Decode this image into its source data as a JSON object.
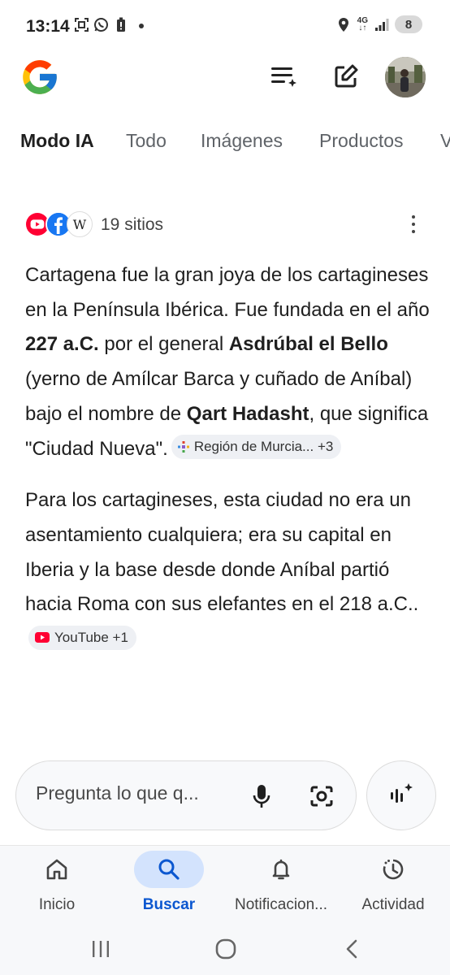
{
  "status_bar": {
    "time": "13:14",
    "network": "4G",
    "battery": "8",
    "icons": [
      "screenshot-icon",
      "whatsapp-icon",
      "battery-saver-icon",
      "location-icon",
      "signal-icon"
    ]
  },
  "header": {
    "logo": "google-logo",
    "icons": [
      "history-icon",
      "new-chat-icon",
      "avatar"
    ]
  },
  "tabs": [
    {
      "label": "Modo IA",
      "active": true
    },
    {
      "label": "Todo"
    },
    {
      "label": "Imágenes"
    },
    {
      "label": "Productos"
    },
    {
      "label": "V"
    }
  ],
  "sources": {
    "count_label": "19 sitios",
    "icons": [
      "youtube-icon",
      "facebook-icon",
      "wikipedia-icon"
    ]
  },
  "answer": {
    "p1": {
      "t1": "Cartagena fue la gran joya de los cartagineses en la Península Ibérica. Fue fundada en el año ",
      "b1": "227 a.C.",
      "t2": " por el general ",
      "b2": "Asdrúbal el Bello",
      "t3": " (yerno de Amílcar Barca y cuñado de Aníbal) bajo el nombre de ",
      "b3": "Qart Hadasht",
      "t4": ", que significa \"Ciudad Nueva\".",
      "chip": "Región de Murcia... +3"
    },
    "p2": {
      "text": "Para los cartagineses, esta ciudad no era un asentamiento cualquiera; era su capital en Iberia y la base desde donde Aníbal partió hacia Roma con sus elefantes en el 218 a.C..",
      "chip": "YouTube +1"
    }
  },
  "search": {
    "placeholder": "Pregunta lo que q..."
  },
  "bottom_nav": [
    {
      "label": "Inicio",
      "icon": "home-icon"
    },
    {
      "label": "Buscar",
      "icon": "search-icon",
      "active": true
    },
    {
      "label": "Notificacion...",
      "icon": "bell-icon"
    },
    {
      "label": "Actividad",
      "icon": "activity-icon"
    }
  ],
  "colors": {
    "accent": "#0b57d0",
    "active_pill": "#d3e3fd",
    "text": "#1f1f1f"
  }
}
